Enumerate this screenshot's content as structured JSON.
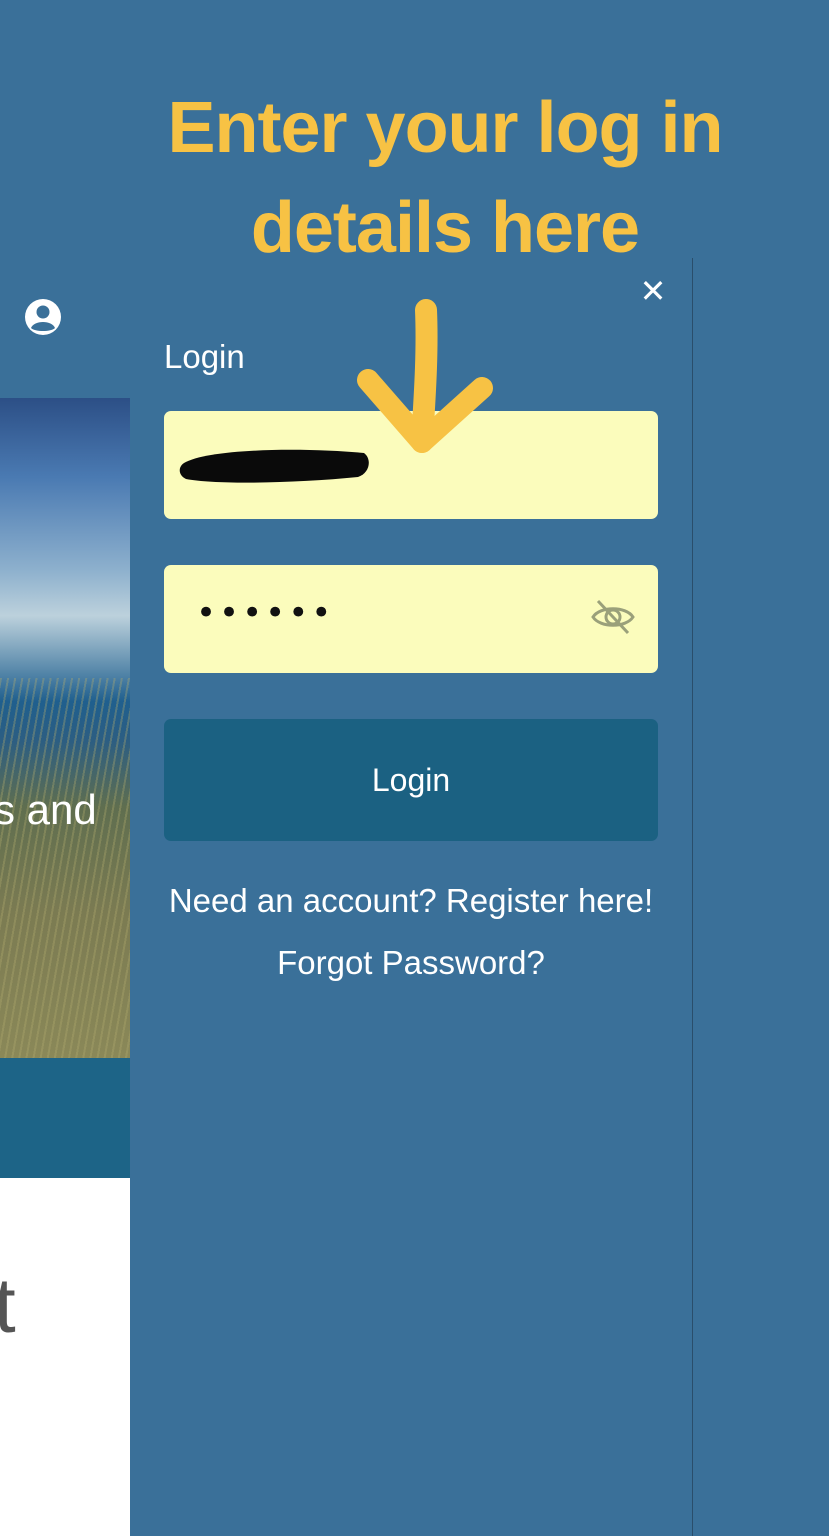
{
  "annotation": {
    "line1": "Enter your log in",
    "line2": "details here",
    "color": "#f7c244"
  },
  "background_page": {
    "hero_text": "s and",
    "lower_text": "t"
  },
  "login_panel": {
    "title": "Login",
    "username_value": "",
    "password_value": "••••••",
    "login_button": "Login",
    "need_account": "Need an account?",
    "register_link": "Register here!",
    "forgot_link": "Forgot Password?"
  },
  "icons": {
    "close": "close-icon",
    "eye": "eye-slash-icon",
    "user": "user-circle-icon"
  },
  "colors": {
    "panel_bg": "#3a7099",
    "field_bg": "#fbfcbc",
    "button_bg": "#1b6182",
    "annotation": "#f7c244"
  }
}
